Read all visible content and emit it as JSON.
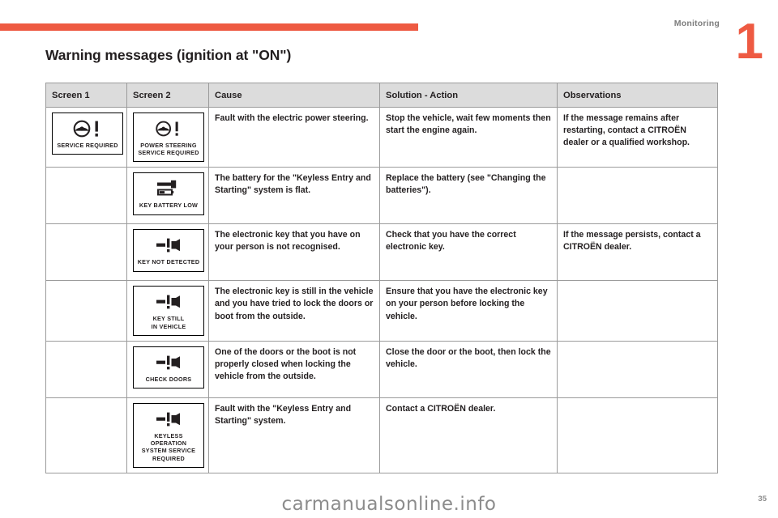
{
  "header": {
    "section_label": "Monitoring",
    "chapter_number": "1",
    "accent_color": "#ee5a42"
  },
  "title": "Warning messages (ignition at \"ON\")",
  "table": {
    "columns": [
      "Screen 1",
      "Screen 2",
      "Cause",
      "Solution - Action",
      "Observations"
    ],
    "rows": [
      {
        "screen1": {
          "icon": "steering-wheel-warning-icon",
          "caption": "SERVICE REQUIRED"
        },
        "screen2": {
          "icon": "steering-wheel-warning-icon",
          "caption": "POWER STEERING\nSERVICE REQUIRED"
        },
        "cause": "Fault with the electric power steering.",
        "solution": "Stop the vehicle, wait few moments then start the engine again.",
        "observations": "If the message remains after restarting, contact a CITROËN dealer or a qualified workshop."
      },
      {
        "screen1": null,
        "screen2": {
          "icon": "key-battery-icon",
          "caption": "KEY BATTERY LOW"
        },
        "cause": "The battery for the \"Keyless Entry and Starting\" system is flat.",
        "solution": "Replace the battery (see \"Changing the batteries\").",
        "observations": ""
      },
      {
        "screen1": null,
        "screen2": {
          "icon": "key-not-detected-icon",
          "caption": "KEY NOT DETECTED"
        },
        "cause": "The electronic key that you have on your person is not recognised.",
        "solution": "Check that you have the correct electronic key.",
        "observations": "If the message persists, contact a CITROËN dealer."
      },
      {
        "screen1": null,
        "screen2": {
          "icon": "key-in-vehicle-icon",
          "caption": "KEY STILL\nIN VEHICLE"
        },
        "cause": "The electronic key is still in the vehicle and you have tried to lock the doors or boot from the outside.",
        "solution": "Ensure that you have the electronic key on your person before locking the vehicle.",
        "observations": ""
      },
      {
        "screen1": null,
        "screen2": {
          "icon": "check-doors-icon",
          "caption": "CHECK DOORS"
        },
        "cause": "One of the doors or the boot is not properly closed when locking the vehicle from the outside.",
        "solution": "Close the door or the boot, then lock the vehicle.",
        "observations": ""
      },
      {
        "screen1": null,
        "screen2": {
          "icon": "keyless-operation-fault-icon",
          "caption": "KEYLESS OPERATION\nSYSTEM SERVICE\nREQUIRED"
        },
        "cause": "Fault with the \"Keyless Entry and Starting\" system.",
        "solution": "Contact a CITROËN dealer.",
        "observations": ""
      }
    ]
  },
  "footer": {
    "watermark": "carmanualsonline.info",
    "page_number": "35"
  }
}
